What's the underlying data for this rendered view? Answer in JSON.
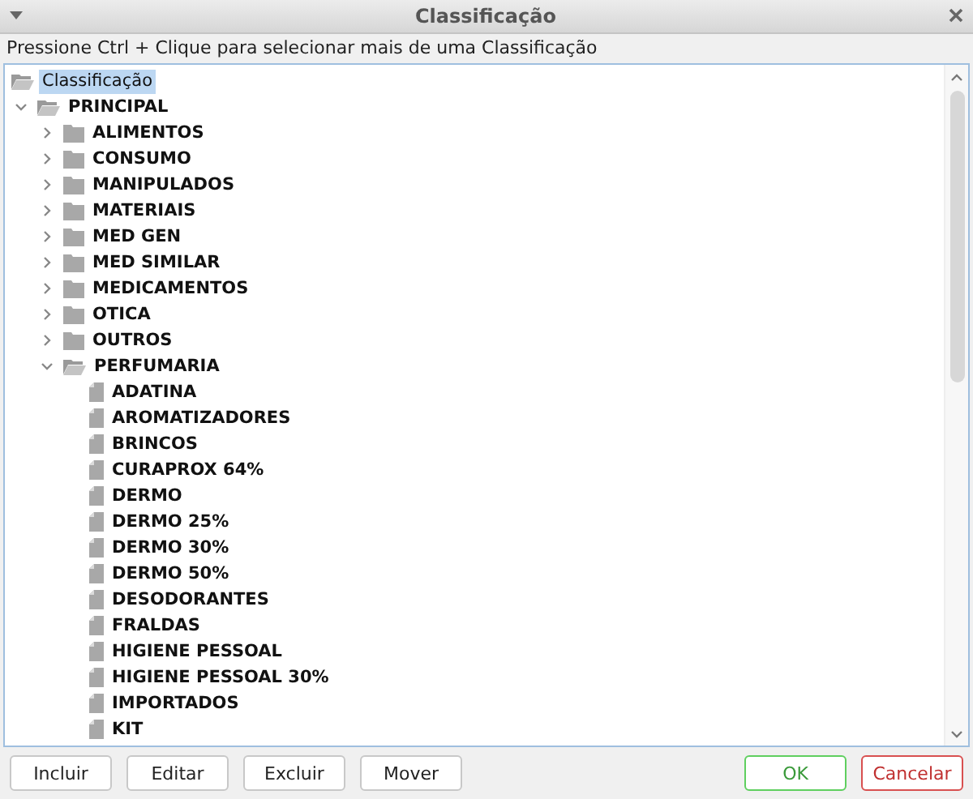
{
  "window": {
    "title": "Classificação"
  },
  "hint": "Pressione Ctrl + Clique para selecionar mais de uma Classificação",
  "tree": [
    {
      "label": "Classificação",
      "kind": "folder",
      "expanded": true,
      "selected": true,
      "children": [
        {
          "label": "PRINCIPAL",
          "kind": "folder",
          "expanded": true,
          "selected": false,
          "children": [
            {
              "label": "ALIMENTOS",
              "kind": "folder",
              "expanded": false,
              "selected": false
            },
            {
              "label": "CONSUMO",
              "kind": "folder",
              "expanded": false,
              "selected": false
            },
            {
              "label": "MANIPULADOS",
              "kind": "folder",
              "expanded": false,
              "selected": false
            },
            {
              "label": "MATERIAIS",
              "kind": "folder",
              "expanded": false,
              "selected": false
            },
            {
              "label": "MED GEN",
              "kind": "folder",
              "expanded": false,
              "selected": false
            },
            {
              "label": "MED SIMILAR",
              "kind": "folder",
              "expanded": false,
              "selected": false
            },
            {
              "label": "MEDICAMENTOS",
              "kind": "folder",
              "expanded": false,
              "selected": false
            },
            {
              "label": "OTICA",
              "kind": "folder",
              "expanded": false,
              "selected": false
            },
            {
              "label": "OUTROS",
              "kind": "folder",
              "expanded": false,
              "selected": false
            },
            {
              "label": "PERFUMARIA",
              "kind": "folder",
              "expanded": true,
              "selected": false,
              "children": [
                {
                  "label": "ADATINA",
                  "kind": "leaf",
                  "selected": false
                },
                {
                  "label": "AROMATIZADORES",
                  "kind": "leaf",
                  "selected": false
                },
                {
                  "label": "BRINCOS",
                  "kind": "leaf",
                  "selected": false
                },
                {
                  "label": "CURAPROX 64%",
                  "kind": "leaf",
                  "selected": false
                },
                {
                  "label": "DERMO",
                  "kind": "leaf",
                  "selected": false
                },
                {
                  "label": "DERMO 25%",
                  "kind": "leaf",
                  "selected": false
                },
                {
                  "label": "DERMO 30%",
                  "kind": "leaf",
                  "selected": false
                },
                {
                  "label": "DERMO 50%",
                  "kind": "leaf",
                  "selected": false
                },
                {
                  "label": "DESODORANTES",
                  "kind": "leaf",
                  "selected": false
                },
                {
                  "label": "FRALDAS",
                  "kind": "leaf",
                  "selected": false
                },
                {
                  "label": "HIGIENE PESSOAL",
                  "kind": "leaf",
                  "selected": false
                },
                {
                  "label": "HIGIENE PESSOAL 30%",
                  "kind": "leaf",
                  "selected": false
                },
                {
                  "label": "IMPORTADOS",
                  "kind": "leaf",
                  "selected": false
                },
                {
                  "label": "KIT",
                  "kind": "leaf",
                  "selected": false
                }
              ]
            }
          ]
        }
      ]
    }
  ],
  "actions": [
    "Incluir",
    "Editar",
    "Excluir",
    "Mover"
  ],
  "dialog_buttons": [
    {
      "label": "OK",
      "kind": "confirm"
    },
    {
      "label": "Cancelar",
      "kind": "cancel"
    }
  ]
}
